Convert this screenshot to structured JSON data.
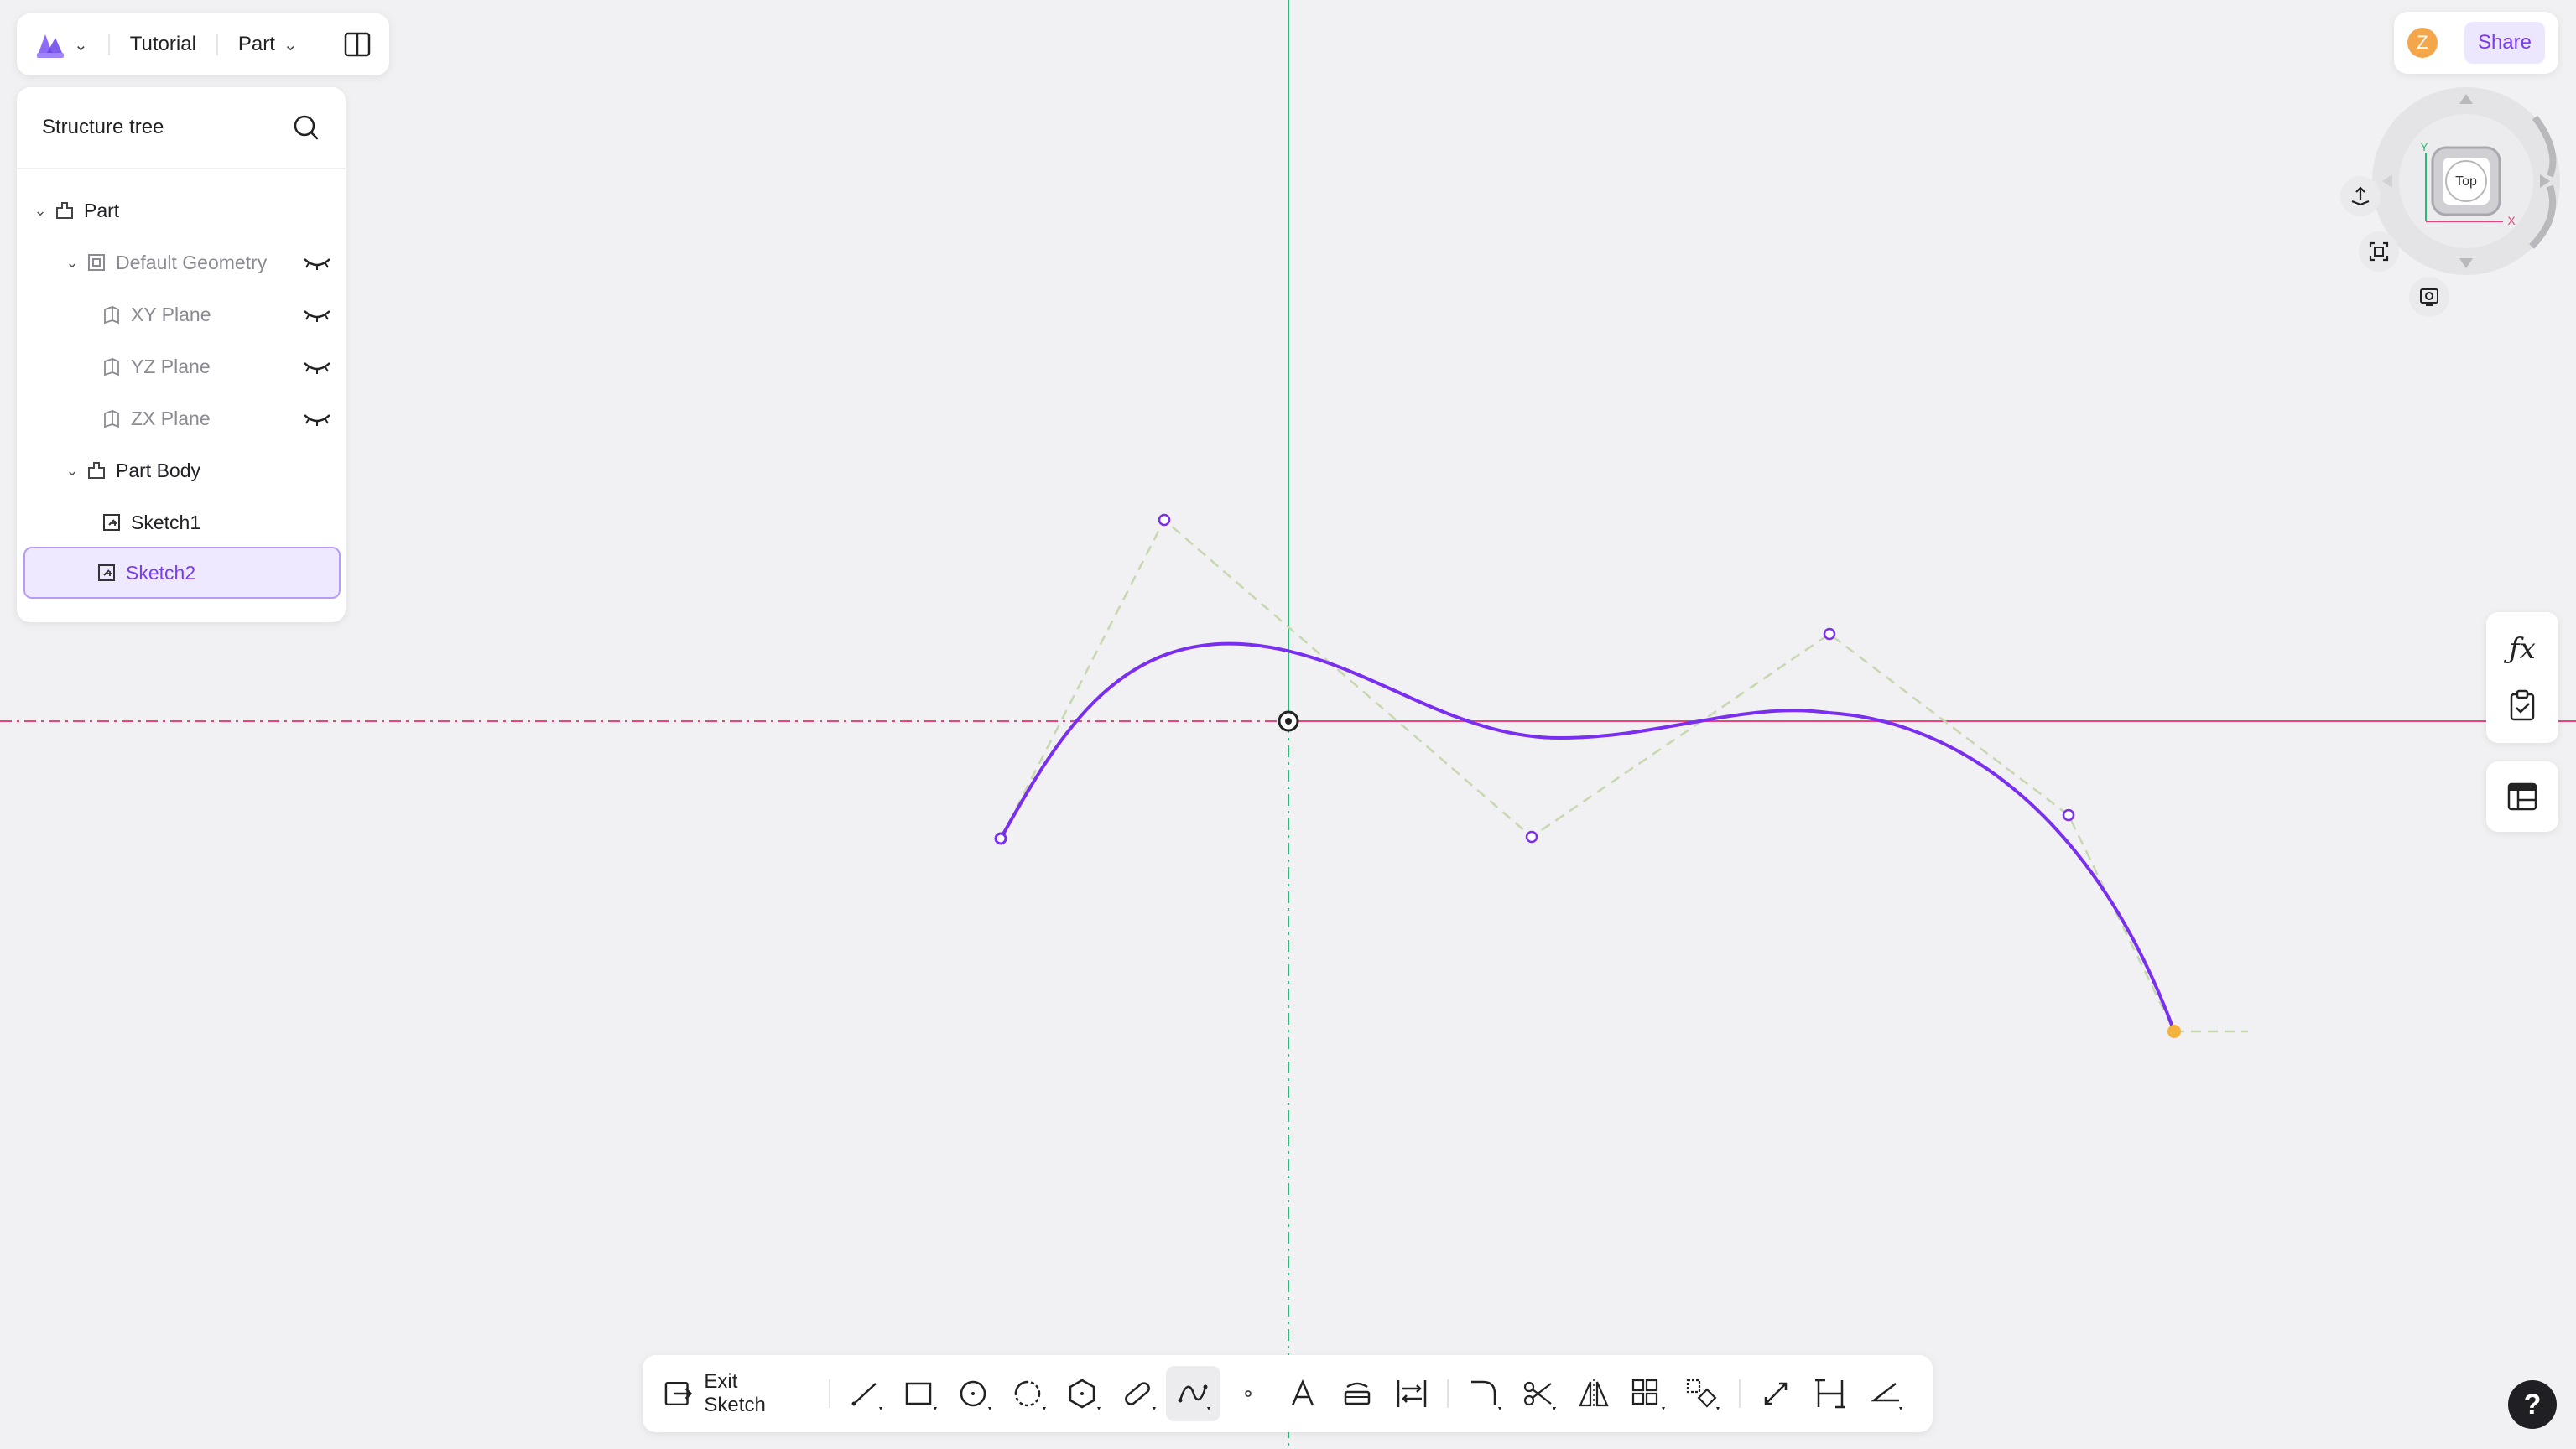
{
  "topbar": {
    "project_name": "Tutorial",
    "mode_label": "Part"
  },
  "tree": {
    "title": "Structure tree",
    "items": [
      {
        "label": "Part"
      },
      {
        "label": "Default Geometry"
      },
      {
        "label": "XY Plane"
      },
      {
        "label": "YZ Plane"
      },
      {
        "label": "ZX Plane"
      },
      {
        "label": "Part Body"
      },
      {
        "label": "Sketch1"
      },
      {
        "label": "Sketch2"
      }
    ]
  },
  "header_right": {
    "avatar_letter": "Z",
    "share_label": "Share"
  },
  "viewcube": {
    "face_label": "Top",
    "axis_x": "X",
    "axis_y": "Y"
  },
  "toolbar": {
    "exit_label": "Exit Sketch"
  },
  "help": {
    "label": "?"
  },
  "colors": {
    "accent": "#7a3cf0",
    "spline": "#7a2ff0",
    "x_axis": "#e8447a",
    "y_axis": "#2fb87a",
    "control_polygon": "#c7d7b0",
    "endpoint_highlight": "#f5b23a"
  },
  "icons": {
    "logo": "app-logo-icon",
    "panel_toggle": "split-panel-icon",
    "search": "search-icon",
    "visibility": "eye-closed-icon",
    "formula": "fx-icon",
    "checklist": "clipboard-check-icon",
    "grid_table": "table-icon"
  }
}
